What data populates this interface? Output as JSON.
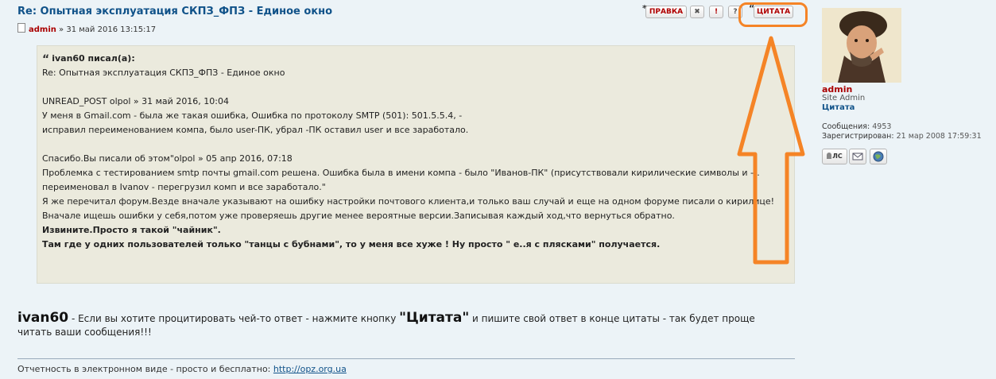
{
  "post": {
    "title": "Re: Опытная эксплуатация СКПЗ_ФПЗ - Единое окно",
    "author": "admin",
    "meta_sep": " » ",
    "date": "31 май 2016 13:15:17"
  },
  "buttons": {
    "edit": "ПРАВКА",
    "delete": "✖",
    "report": "!",
    "info": "?",
    "quote": "ЦИТАТА"
  },
  "quote": {
    "author_label": "ivan60 писал(а):",
    "lines": [
      "Re: Опытная эксплуатация СКПЗ_ФПЗ - Единое окно",
      "",
      "UNREAD_POST olpol » 31 май 2016, 10:04",
      "У меня в Gmail.com - была же такая ошибка, Ошибка по протоколу SMTP (501): 501.5.5.4, -",
      "исправил переименованием компа, было user-ПК, убрал -ПК оставил user и все заработало.",
      "",
      "Спасибо.Вы писали об этом\"olpol » 05 апр 2016, 07:18",
      "Проблемка с тестированием smtp почты gmail.com решена. Ошибка была в имени компа - было \"Иванов-ПК\" (присутствовали кирилические символы и -).",
      "переименовал в Ivanov - перегрузил комп и все заработало.\"",
      "Я же перечитал форум.Везде вначале указывают на ошибку настройки почтового клиента,и только ваш случай и еще на одном форуме писали о кирилице!",
      "Вначале ищешь ошибки у себя,потом уже проверяешь другие менее вероятные версии.Записывая каждый ход,что вернуться обратно.",
      "Извините.Просто я такой \"чайник\".",
      "Там где у одних пользователей только \"танцы с бубнами\", то у меня все хуже ! Ну просто \" е..я с плясками\" получается."
    ]
  },
  "reply": {
    "name": "ivan60",
    "text_before": " - Если вы хотите процитировать чей-то ответ - нажмите кнопку ",
    "quote_word": "\"Цитата\"",
    "text_after": " и пишите свой ответ в конце цитаты - так будет проще читать ваши сообщения!!!"
  },
  "signature": {
    "text": "Отчетность в электронном виде - просто и бесплатно: ",
    "link": "http://opz.org.ua"
  },
  "profile": {
    "name": "admin",
    "rank": "Site Admin",
    "quote_link": "Цитата",
    "posts_label": "Сообщения:",
    "posts_value": "4953",
    "registered_label": "Зарегистрирован:",
    "registered_value": "21 мар 2008 17:59:31",
    "pm_label": "ЛС"
  },
  "colors": {
    "highlight": "#f58426",
    "author": "#aa0000",
    "title": "#105289",
    "quote_bg": "#ebeadd"
  },
  "icons": [
    "document-icon",
    "delete-icon",
    "report-icon",
    "info-icon",
    "quote-icon",
    "email-icon",
    "website-icon"
  ]
}
